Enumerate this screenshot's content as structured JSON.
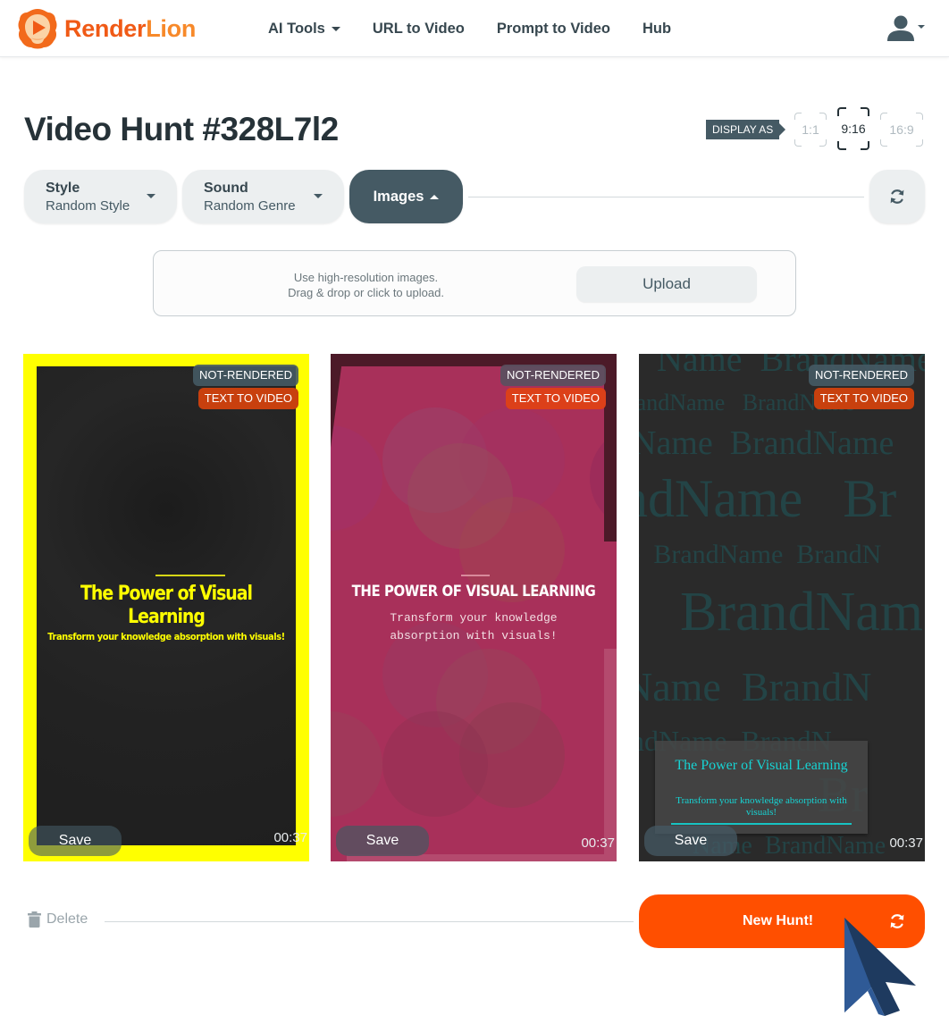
{
  "header": {
    "logo": {
      "part1": "Render",
      "part2": "Lion"
    },
    "nav": [
      {
        "label": "AI Tools",
        "has_dropdown": true
      },
      {
        "label": "URL to Video"
      },
      {
        "label": "Prompt to Video"
      },
      {
        "label": "Hub"
      }
    ],
    "user_icon": "user-icon"
  },
  "page": {
    "title": "Video Hunt #328L7l2",
    "display_as": {
      "label": "DISPLAY AS",
      "options": [
        "1:1",
        "9:16",
        "16:9"
      ],
      "selected": "9:16"
    }
  },
  "controls": {
    "style": {
      "title": "Style",
      "value": "Random Style"
    },
    "sound": {
      "title": "Sound",
      "value": "Random Genre"
    },
    "images": {
      "label": "Images",
      "expanded": true
    },
    "refresh_icon": "refresh-icon"
  },
  "upload": {
    "hint_line1": "Use high-resolution images.",
    "hint_line2": "Drag & drop or click to upload.",
    "button": "Upload"
  },
  "videos": [
    {
      "status": "NOT-RENDERED",
      "type": "TEXT TO VIDEO",
      "title": "The Power of Visual Learning",
      "subtitle": "Transform your knowledge absorption with visuals!",
      "save_label": "Save",
      "duration": "00:37",
      "selected": true,
      "accent": "#ffff00"
    },
    {
      "status": "NOT-RENDERED",
      "type": "TEXT TO VIDEO",
      "title": "THE POWER OF VISUAL LEARNING",
      "subtitle": "Transform your knowledge absorption with visuals!",
      "save_label": "Save",
      "duration": "00:37",
      "selected": false,
      "accent": "#a8305a"
    },
    {
      "status": "NOT-RENDERED",
      "type": "TEXT TO VIDEO",
      "title": "The Power of Visual Learning",
      "subtitle": "Transform your knowledge absorption with visuals!",
      "watermark": "BrandName",
      "save_label": "Save",
      "duration": "00:37",
      "selected": false,
      "accent": "#17d3d3"
    }
  ],
  "footer": {
    "delete_label": "Delete",
    "new_hunt_label": "New Hunt!"
  },
  "colors": {
    "brand_orange": "#ff4f00",
    "slate": "#455a64",
    "badge_type": "#c8400e"
  }
}
